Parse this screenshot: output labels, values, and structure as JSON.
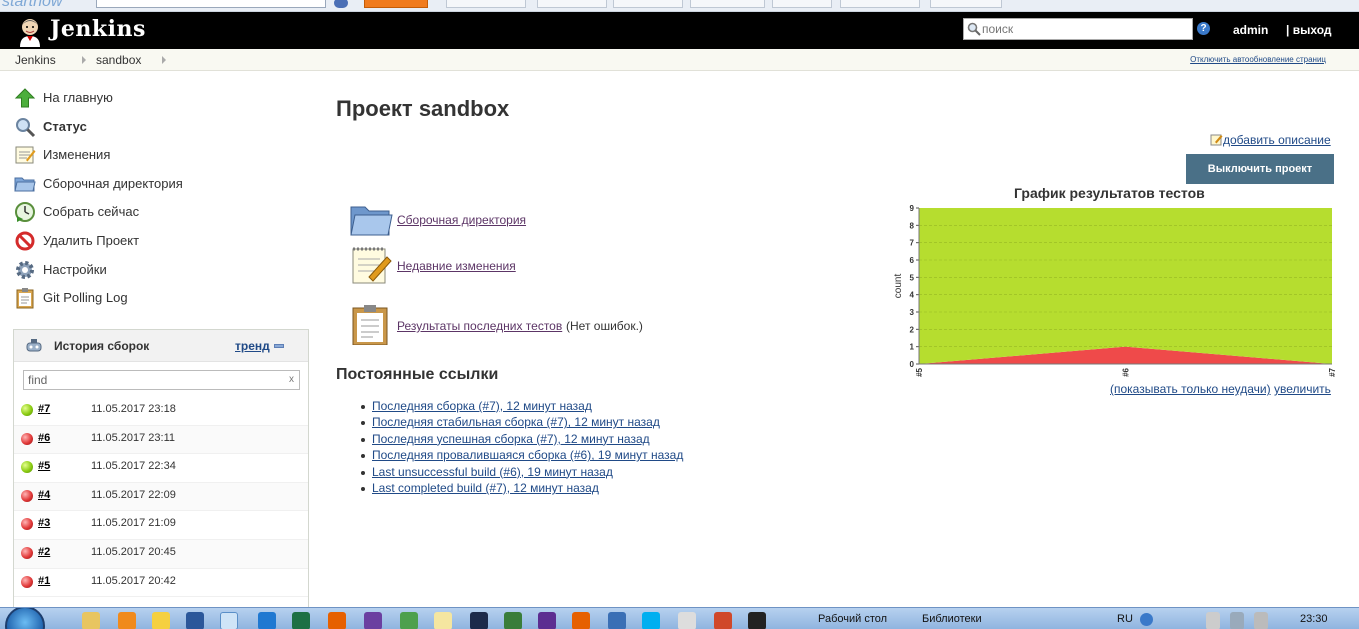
{
  "browser": {
    "logo_text": "startnow"
  },
  "header": {
    "brand": "Jenkins",
    "search_placeholder": "поиск",
    "help_glyph": "?",
    "user": "admin",
    "logout": "| выход"
  },
  "breadcrumb": {
    "items": [
      "Jenkins",
      "sandbox"
    ],
    "autorefresh": "Отключить автообновление страниц"
  },
  "tasks": [
    {
      "label": "На главную",
      "icon": "up-arrow-icon"
    },
    {
      "label": "Статус",
      "icon": "magnifier-icon"
    },
    {
      "label": "Изменения",
      "icon": "notepad-icon"
    },
    {
      "label": "Сборочная директория",
      "icon": "folder-icon"
    },
    {
      "label": "Собрать сейчас",
      "icon": "clock-play-icon"
    },
    {
      "label": "Удалить Проект",
      "icon": "no-entry-icon"
    },
    {
      "label": "Настройки",
      "icon": "gear-icon"
    },
    {
      "label": "Git Polling Log",
      "icon": "clipboard-icon"
    }
  ],
  "history": {
    "title": "История сборок",
    "trend": "тренд",
    "filter_value": "find",
    "clear": "x",
    "builds": [
      {
        "num": "#7",
        "date": "11.05.2017 23:18",
        "status": "blue"
      },
      {
        "num": "#6",
        "date": "11.05.2017 23:11",
        "status": "red"
      },
      {
        "num": "#5",
        "date": "11.05.2017 22:34",
        "status": "blue"
      },
      {
        "num": "#4",
        "date": "11.05.2017 22:09",
        "status": "red"
      },
      {
        "num": "#3",
        "date": "11.05.2017 21:09",
        "status": "red"
      },
      {
        "num": "#2",
        "date": "11.05.2017 20:45",
        "status": "red"
      },
      {
        "num": "#1",
        "date": "11.05.2017 20:42",
        "status": "red"
      }
    ]
  },
  "main": {
    "title": "Проект sandbox",
    "add_description": "добавить описание",
    "disable_button": "Выключить проект",
    "links": [
      {
        "label": "Сборочная директория",
        "suffix": "",
        "icon": "folder-icon"
      },
      {
        "label": "Недавние изменения",
        "suffix": "",
        "icon": "notepad-icon"
      },
      {
        "label": "Результаты последних тестов",
        "suffix": "(Нет ошибок.)",
        "icon": "clipboard-icon"
      }
    ],
    "permalinks_title": "Постоянные ссылки",
    "permalinks": [
      "Последняя сборка (#7), 12 минут назад",
      "Последняя стабильная сборка (#7), 12 минут назад",
      "Последняя успешная сборка (#7), 12 минут назад",
      "Последняя провалившаяся сборка (#6), 19 минут назад",
      "Last unsuccessful build (#6), 19 минут назад",
      "Last completed build (#7), 12 минут назад"
    ]
  },
  "chart_links": {
    "failures_only": "(показывать только неудачи)",
    "enlarge": "увеличить"
  },
  "chart_data": {
    "type": "area",
    "title": "График результатов тестов",
    "xlabel": "",
    "ylabel": "count",
    "categories": [
      "#5",
      "#6",
      "#7"
    ],
    "ylim": [
      0,
      9
    ],
    "yticks": [
      0,
      1,
      2,
      3,
      4,
      5,
      6,
      7,
      8,
      9
    ],
    "series": [
      {
        "values": [
          0,
          1,
          0
        ],
        "color": "#ef4a4a"
      },
      {
        "values": [
          9,
          8,
          9
        ],
        "color": "#b6dd2f"
      }
    ]
  },
  "taskbar": {
    "items": [
      "Рабочий стол",
      "Библиотеки"
    ],
    "lang": "RU",
    "clock": "23:30"
  }
}
